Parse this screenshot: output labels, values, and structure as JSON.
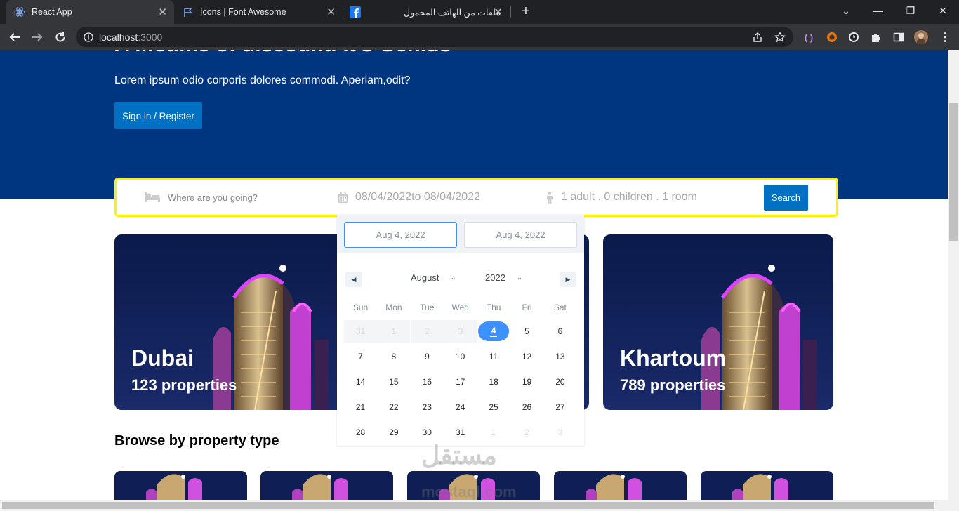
{
  "browser": {
    "tabs": [
      {
        "title": "React App",
        "active": true
      },
      {
        "title": "Icons | Font Awesome",
        "active": false
      },
      {
        "title": "ملفات من الهاتف المحمول",
        "active": false
      }
    ],
    "address": {
      "host": "localhost",
      "port": ":3000"
    }
  },
  "hero": {
    "title": "A lifetime of discount. It's Genius",
    "description": "Lorem ipsum odio corporis dolores commodi. Aperiam,odit?",
    "signin_label": "Sign in / Register"
  },
  "search": {
    "destination_placeholder": "Where are you going?",
    "dates_text": "08/04/2022to 08/04/2022",
    "options_text": "1 adult . 0 children . 1 room",
    "button_label": "Search"
  },
  "datepicker": {
    "start_input": "Aug 4, 2022",
    "end_input": "Aug 4, 2022",
    "month": "August",
    "year": "2022",
    "weekdays": [
      "Sun",
      "Mon",
      "Tue",
      "Wed",
      "Thu",
      "Fri",
      "Sat"
    ],
    "weeks": [
      [
        "31",
        "1",
        "2",
        "3",
        "4",
        "5",
        "6"
      ],
      [
        "7",
        "8",
        "9",
        "10",
        "11",
        "12",
        "13"
      ],
      [
        "14",
        "15",
        "16",
        "17",
        "18",
        "19",
        "20"
      ],
      [
        "21",
        "22",
        "23",
        "24",
        "25",
        "26",
        "27"
      ],
      [
        "28",
        "29",
        "30",
        "31",
        "1",
        "2",
        "3"
      ]
    ],
    "selected_day": "4"
  },
  "featured": [
    {
      "city": "Dubai",
      "properties": "123 properties"
    },
    {
      "city": "Khartoum",
      "properties": "789 properties"
    }
  ],
  "section_title": "Browse by property type",
  "watermark": {
    "arabic": "مستقل",
    "latin": "mostaql.com"
  }
}
